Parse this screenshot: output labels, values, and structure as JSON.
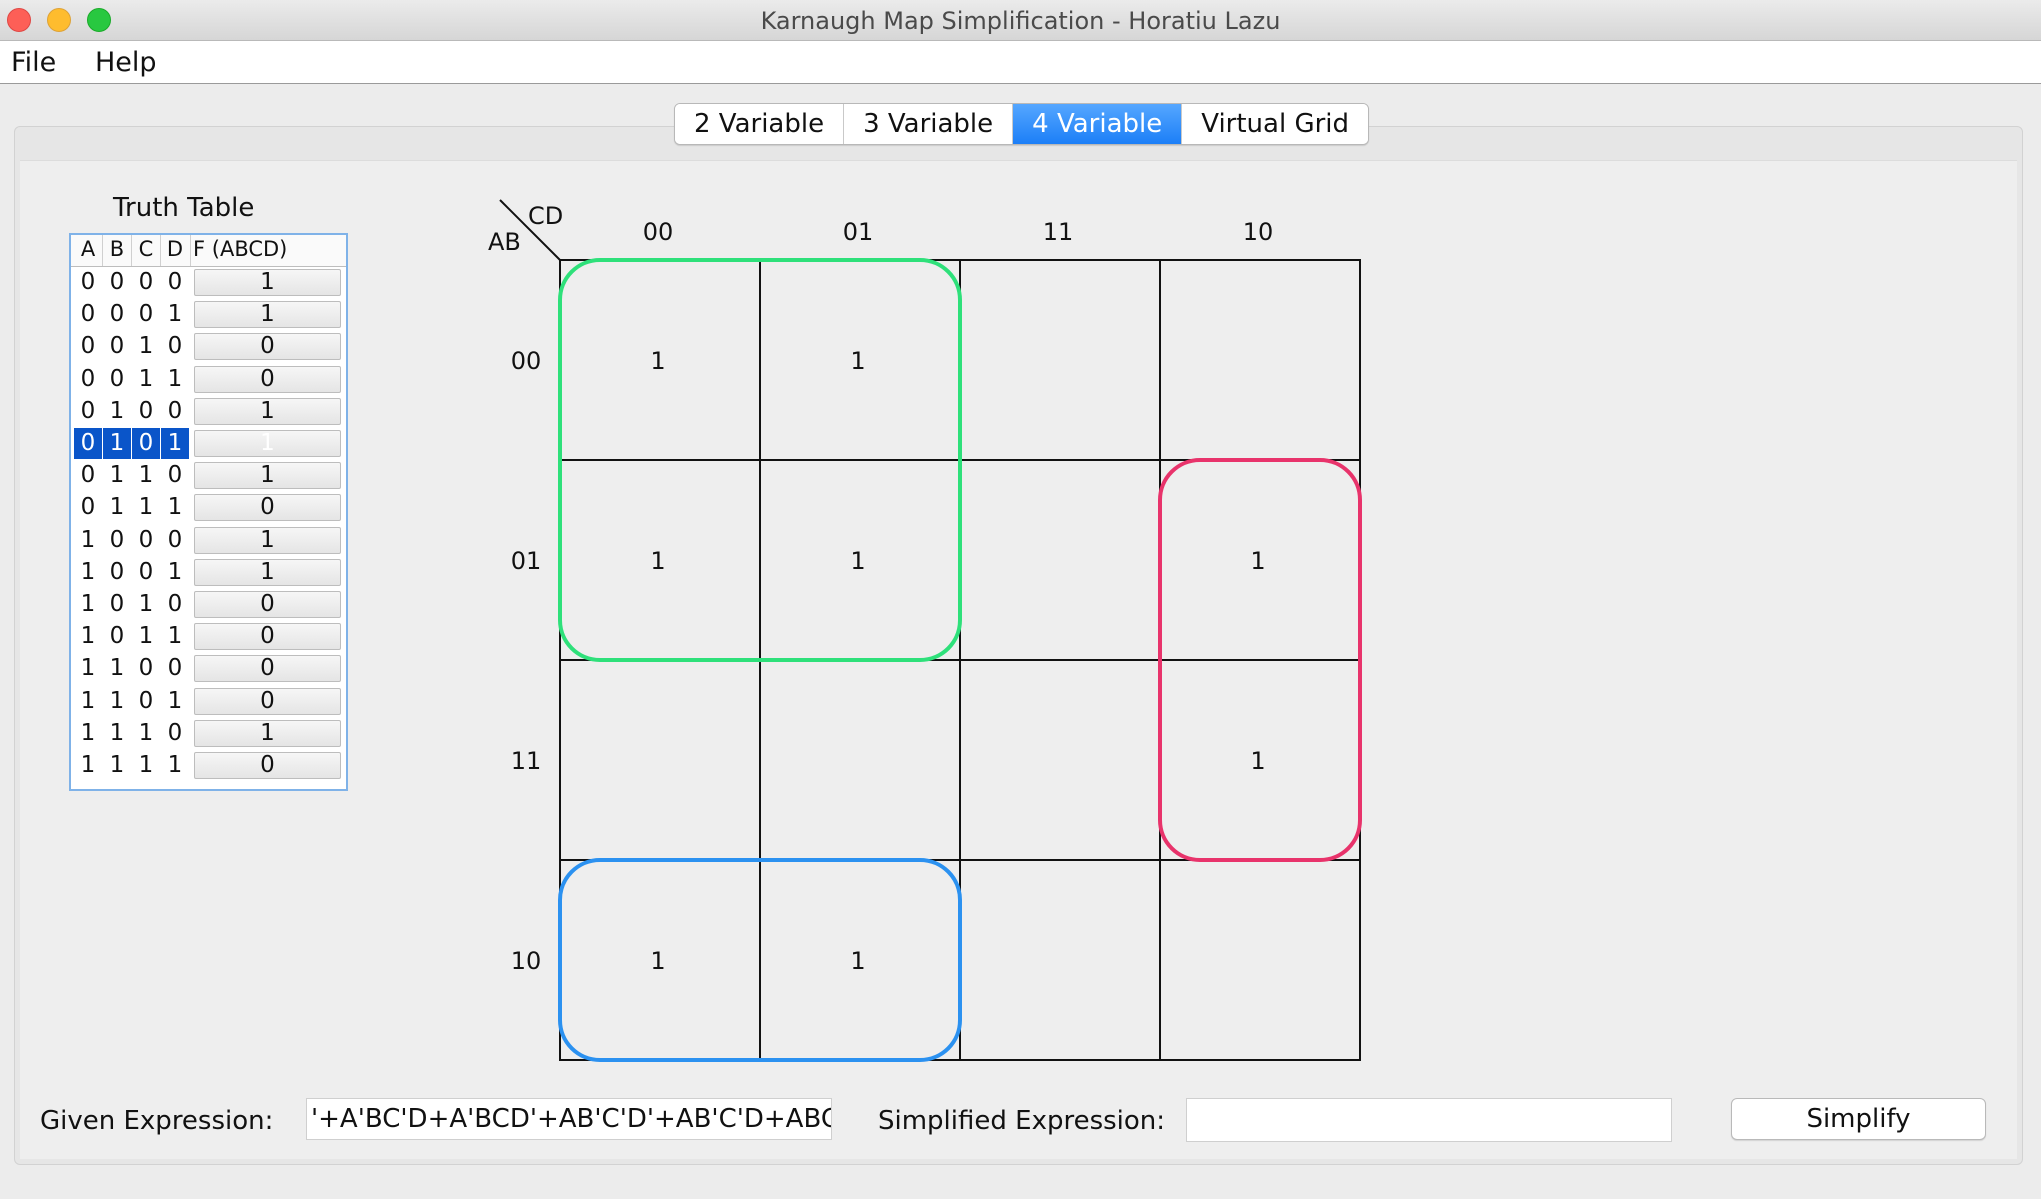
{
  "window": {
    "title": "Karnaugh Map Simplification - Horatiu Lazu"
  },
  "menu": {
    "file": "File",
    "help": "Help"
  },
  "tabs": [
    {
      "label": "2 Variable",
      "active": false
    },
    {
      "label": "3 Variable",
      "active": false
    },
    {
      "label": "4 Variable",
      "active": true
    },
    {
      "label": "Virtual Grid",
      "active": false
    }
  ],
  "truth_table": {
    "title": "Truth Table",
    "headers": [
      "A",
      "B",
      "C",
      "D",
      "F (ABCD)"
    ],
    "selected_row": 5,
    "rows": [
      {
        "a": "0",
        "b": "0",
        "c": "0",
        "d": "0",
        "f": "1"
      },
      {
        "a": "0",
        "b": "0",
        "c": "0",
        "d": "1",
        "f": "1"
      },
      {
        "a": "0",
        "b": "0",
        "c": "1",
        "d": "0",
        "f": "0"
      },
      {
        "a": "0",
        "b": "0",
        "c": "1",
        "d": "1",
        "f": "0"
      },
      {
        "a": "0",
        "b": "1",
        "c": "0",
        "d": "0",
        "f": "1"
      },
      {
        "a": "0",
        "b": "1",
        "c": "0",
        "d": "1",
        "f": "1"
      },
      {
        "a": "0",
        "b": "1",
        "c": "1",
        "d": "0",
        "f": "1"
      },
      {
        "a": "0",
        "b": "1",
        "c": "1",
        "d": "1",
        "f": "0"
      },
      {
        "a": "1",
        "b": "0",
        "c": "0",
        "d": "0",
        "f": "1"
      },
      {
        "a": "1",
        "b": "0",
        "c": "0",
        "d": "1",
        "f": "1"
      },
      {
        "a": "1",
        "b": "0",
        "c": "1",
        "d": "0",
        "f": "0"
      },
      {
        "a": "1",
        "b": "0",
        "c": "1",
        "d": "1",
        "f": "0"
      },
      {
        "a": "1",
        "b": "1",
        "c": "0",
        "d": "0",
        "f": "0"
      },
      {
        "a": "1",
        "b": "1",
        "c": "0",
        "d": "1",
        "f": "0"
      },
      {
        "a": "1",
        "b": "1",
        "c": "1",
        "d": "0",
        "f": "1"
      },
      {
        "a": "1",
        "b": "1",
        "c": "1",
        "d": "1",
        "f": "0"
      }
    ]
  },
  "kmap": {
    "row_var": "AB",
    "col_var": "CD",
    "col_labels": [
      "00",
      "01",
      "11",
      "10"
    ],
    "row_labels": [
      "00",
      "01",
      "11",
      "10"
    ],
    "cells": [
      [
        "1",
        "1",
        "",
        ""
      ],
      [
        "1",
        "1",
        "",
        "1"
      ],
      [
        "",
        "",
        "",
        "1"
      ],
      [
        "1",
        "1",
        "",
        ""
      ]
    ],
    "groups": [
      {
        "name": "green-group",
        "color": "#2ee07a",
        "row_start": 0,
        "row_end": 1,
        "col_start": 0,
        "col_end": 1
      },
      {
        "name": "pink-group",
        "color": "#e8336b",
        "row_start": 1,
        "row_end": 2,
        "col_start": 3,
        "col_end": 3
      },
      {
        "name": "blue-group",
        "color": "#2b91f0",
        "row_start": 3,
        "row_end": 3,
        "col_start": 0,
        "col_end": 1
      }
    ]
  },
  "expressions": {
    "given_label": "Given Expression:",
    "given_value": "'+A'BC'D+A'BCD'+AB'C'D'+AB'C'D+ABCD'",
    "simplified_label": "Simplified Expression:",
    "simplified_value": ""
  },
  "simplify_button": "Simplify"
}
